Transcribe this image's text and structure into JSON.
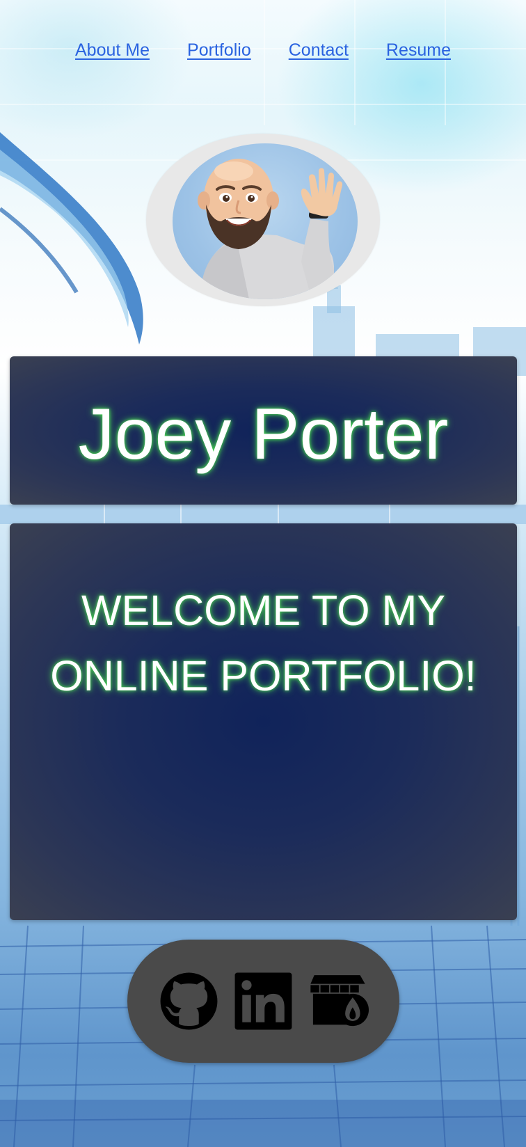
{
  "nav": {
    "links": [
      {
        "label": "About Me"
      },
      {
        "label": "Portfolio"
      },
      {
        "label": "Contact"
      },
      {
        "label": "Resume"
      }
    ]
  },
  "hero": {
    "name": "Joey Porter"
  },
  "welcome": {
    "line1": "WELCOME TO MY",
    "line2": "ONLINE PORTFOLIO!"
  },
  "social": {
    "icons": [
      "github-icon",
      "linkedin-icon",
      "store-icon"
    ]
  },
  "colors": {
    "link": "#2a63e0",
    "panel": "#1b2b5a",
    "glow": "#4ce650",
    "social_bg": "#4a4a4a"
  }
}
